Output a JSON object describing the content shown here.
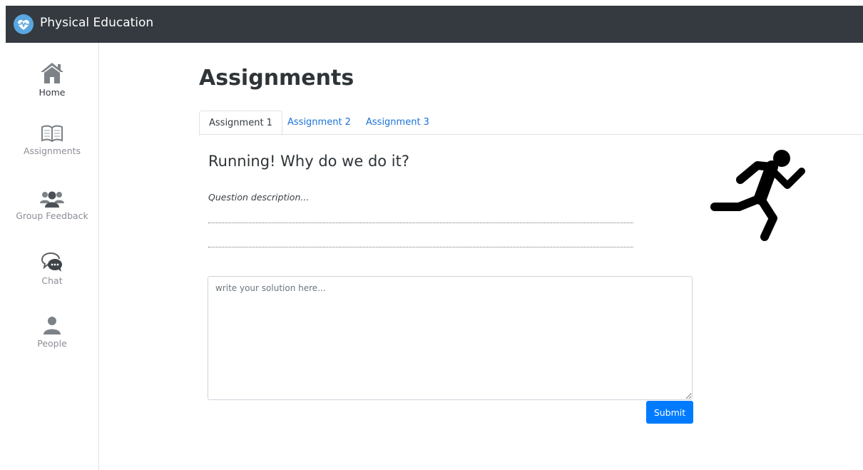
{
  "app": {
    "title": "Physical Education",
    "logo_icon": "heart-pulse-icon"
  },
  "sidebar": {
    "items": [
      {
        "label": "Home",
        "icon": "home-icon",
        "active": true
      },
      {
        "label": "Assignments",
        "icon": "book-icon",
        "active": false
      },
      {
        "label": "Group Feedback",
        "icon": "group-icon",
        "active": false
      },
      {
        "label": "Chat",
        "icon": "chat-icon",
        "active": false
      },
      {
        "label": "People",
        "icon": "person-icon",
        "active": false
      }
    ]
  },
  "main": {
    "title": "Assignments",
    "tabs": [
      {
        "label": "Assignment 1",
        "active": true
      },
      {
        "label": "Assignment 2",
        "active": false
      },
      {
        "label": "Assignment 3",
        "active": false
      }
    ],
    "question": {
      "title": "Running! Why do we do it?",
      "description": "Question description...",
      "illustration": "running-person-icon"
    },
    "solution": {
      "placeholder": "write your solution here...",
      "value": ""
    },
    "submit_label": "Submit"
  },
  "colors": {
    "topbar": "#343a40",
    "accent": "#007bff",
    "link": "#1a73d9",
    "muted": "#8a8f95"
  }
}
